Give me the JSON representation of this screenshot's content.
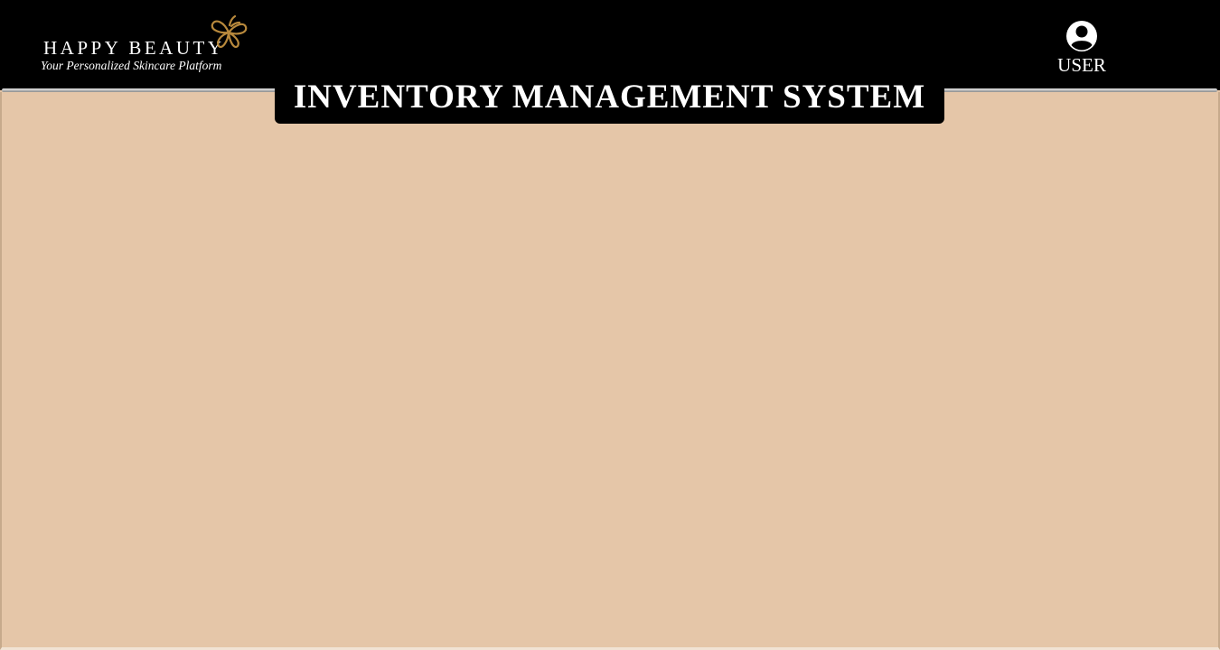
{
  "header": {
    "brand_name": "HAPPY BEAUTY",
    "tagline": "Your Personalized Skincare Platform",
    "logo_icon": "butterfly-icon",
    "user_label": "USER",
    "user_icon": "user-circle-icon"
  },
  "page": {
    "title": "INVENTORY MANAGEMENT SYSTEM"
  },
  "colors": {
    "header_background": "#000000",
    "content_background": "#e5c6a8",
    "logo_accent": "#b8893c",
    "text": "#ffffff"
  }
}
